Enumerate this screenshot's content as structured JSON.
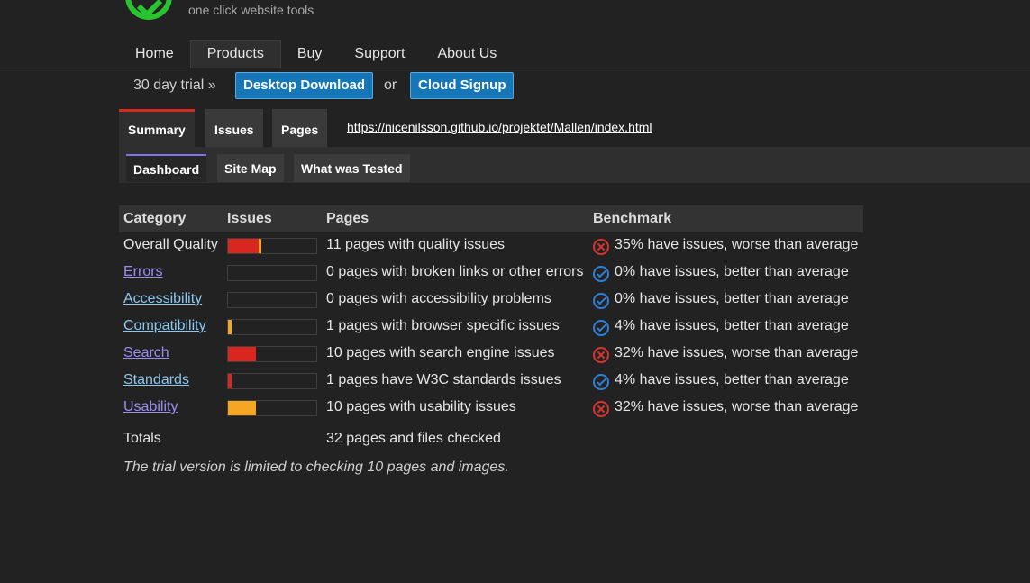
{
  "header": {
    "tagline": "one click website tools",
    "logo_color": "#29c32f"
  },
  "nav": {
    "items": [
      "Home",
      "Products",
      "Buy",
      "Support",
      "About Us"
    ],
    "active": "Products"
  },
  "trial": {
    "label": "30 day trial »",
    "desktop_button": "Desktop Download",
    "or": "or",
    "cloud_button": "Cloud Signup"
  },
  "tabs": {
    "items": [
      "Summary",
      "Issues",
      "Pages"
    ],
    "active": "Summary",
    "url": "https://nicenilsson.github.io/projektet/Mallen/index.html"
  },
  "subtabs": {
    "items": [
      "Dashboard",
      "Site Map",
      "What was Tested"
    ],
    "active": "Dashboard"
  },
  "table": {
    "headers": [
      "Category",
      "Issues",
      "Pages",
      "Benchmark"
    ],
    "rows": [
      {
        "category": "Overall Quality",
        "link": false,
        "issues_pct": 0.35,
        "issues_color": "#d9261f",
        "accent": true,
        "pages": "11 pages with quality issues",
        "bench_status": "bad",
        "benchmark": "35% have issues, worse than average"
      },
      {
        "category": "Errors",
        "link": true,
        "issues_pct": 0.0,
        "issues_color": "#d9261f",
        "pages": "0 pages with broken links or other errors",
        "bench_status": "good",
        "benchmark": "0% have issues, better than average"
      },
      {
        "category": "Accessibility",
        "link": true,
        "visited": true,
        "issues_pct": 0.0,
        "issues_color": "#d9261f",
        "pages": "0 pages with accessibility problems",
        "bench_status": "good",
        "benchmark": "0% have issues, better than average"
      },
      {
        "category": "Compatibility",
        "link": true,
        "visited": true,
        "issues_pct": 0.04,
        "issues_color": "#f5a623",
        "pages": "1 pages with browser specific issues",
        "bench_status": "good",
        "benchmark": "4% have issues, better than average"
      },
      {
        "category": "Search",
        "link": true,
        "issues_pct": 0.32,
        "issues_color": "#d9261f",
        "pages": "10 pages with search engine issues",
        "bench_status": "bad",
        "benchmark": "32% have issues, worse than average"
      },
      {
        "category": "Standards",
        "link": true,
        "visited": true,
        "issues_pct": 0.04,
        "issues_color": "#d9261f",
        "pages": "1 pages have W3C standards issues",
        "bench_status": "good",
        "benchmark": "4% have issues, better than average"
      },
      {
        "category": "Usability",
        "link": true,
        "issues_pct": 0.32,
        "issues_color": "#f5a623",
        "pages": "10 pages with usability issues",
        "bench_status": "bad",
        "benchmark": "32% have issues, worse than average"
      }
    ],
    "totals_label": "Totals",
    "totals_text": "32 pages and files checked",
    "note": "The trial version is limited to checking 10 pages and images."
  }
}
